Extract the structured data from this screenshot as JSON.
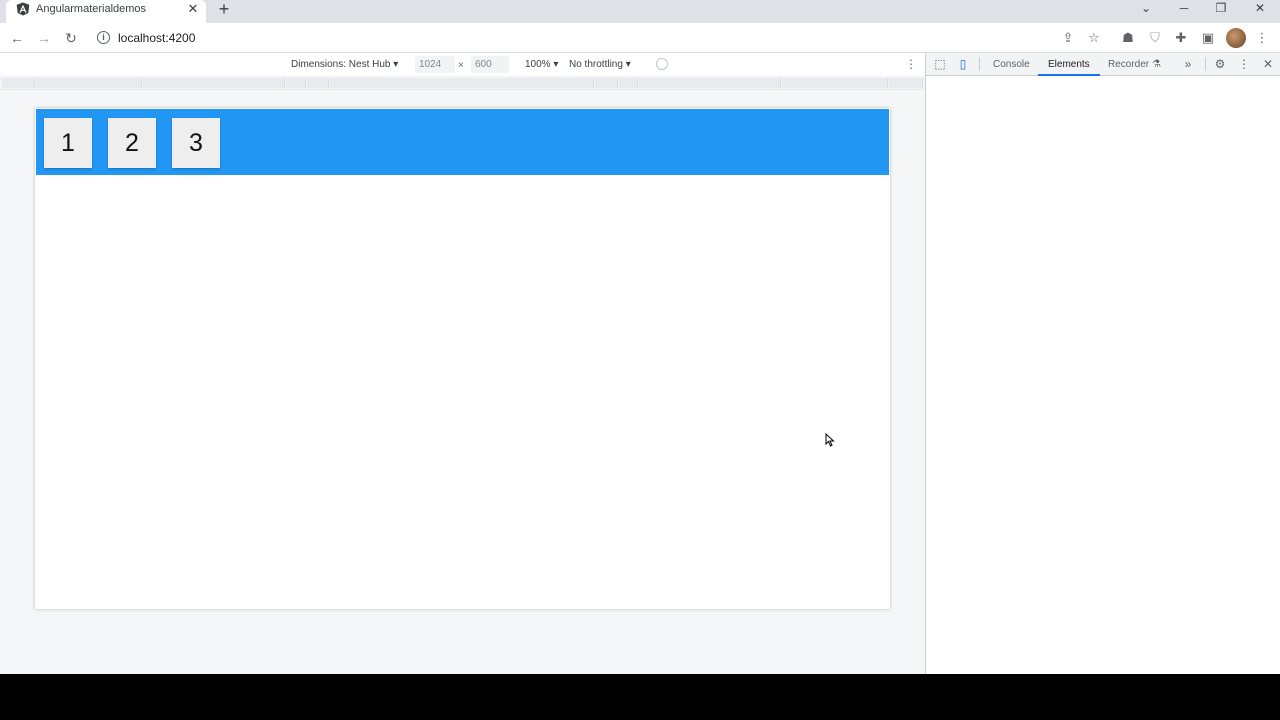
{
  "browser": {
    "tab_title": "Angularmaterialdemos",
    "tab_close": "✕",
    "new_tab": "+",
    "url": "localhost:4200",
    "window_controls": {
      "tabsearch": "⌄",
      "minimize": "─",
      "restore": "❐",
      "close": "✕"
    }
  },
  "device_toolbar": {
    "dimensions_label": "Dimensions: Nest Hub ▾",
    "width": "1024",
    "times": "×",
    "height": "600",
    "zoom": "100% ▾",
    "throttling": "No throttling ▾",
    "more": "⋮"
  },
  "app": {
    "accent_color": "#2196f3",
    "buttons": [
      "1",
      "2",
      "3"
    ]
  },
  "devtools": {
    "tabs": [
      "Console",
      "Elements",
      "Recorder"
    ],
    "active_tab": "Elements",
    "recorder_badge": "⚗",
    "more_tabs": "»",
    "settings": "⚙",
    "menu": "⋮",
    "close": "✕"
  }
}
